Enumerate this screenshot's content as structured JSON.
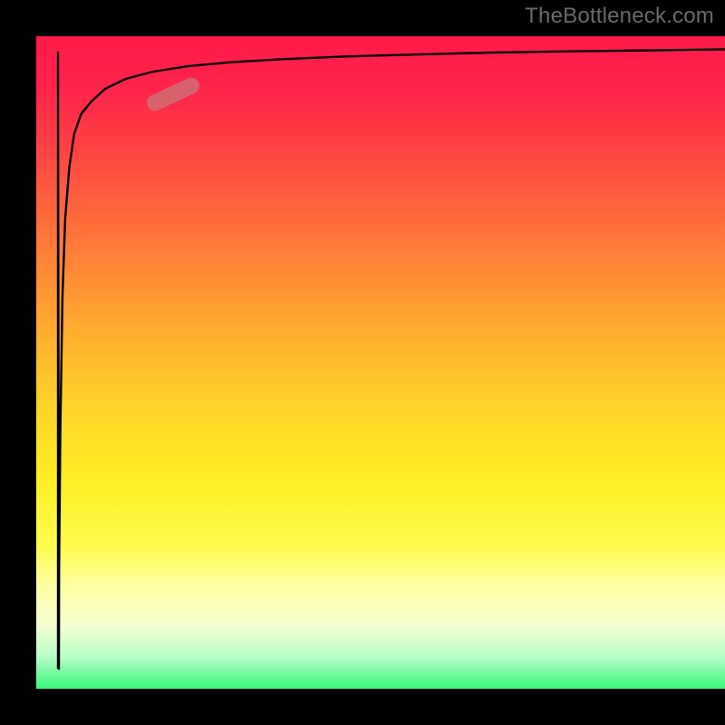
{
  "watermark": "TheBottleneck.com",
  "chart_data": {
    "type": "line",
    "title": "",
    "xlabel": "",
    "ylabel": "",
    "xlim": [
      0,
      100
    ],
    "ylim": [
      0,
      100
    ],
    "grid": false,
    "legend_position": "none",
    "background_gradient": {
      "top_color": "#ff1a4a",
      "mid_color": "#ffd627",
      "bottom_color": "#38f57a"
    },
    "series": [
      {
        "name": "curve",
        "color": "#000000",
        "x": [
          3.2,
          3.3,
          3.5,
          3.8,
          4.2,
          4.8,
          5.5,
          6.5,
          8,
          10,
          13,
          17,
          22,
          28,
          36,
          45,
          55,
          66,
          78,
          90,
          100
        ],
        "y": [
          3,
          15,
          40,
          60,
          72,
          80,
          85,
          88,
          90,
          92,
          93.5,
          94.6,
          95.4,
          96,
          96.5,
          96.9,
          97.2,
          97.5,
          97.7,
          97.85,
          98
        ]
      },
      {
        "name": "drop",
        "color": "#000000",
        "x": [
          3.2,
          3.2
        ],
        "y": [
          98,
          3
        ]
      }
    ],
    "highlight": {
      "x_range": [
        17,
        24
      ],
      "color": "#c67a7a",
      "opacity": 0.72
    }
  }
}
